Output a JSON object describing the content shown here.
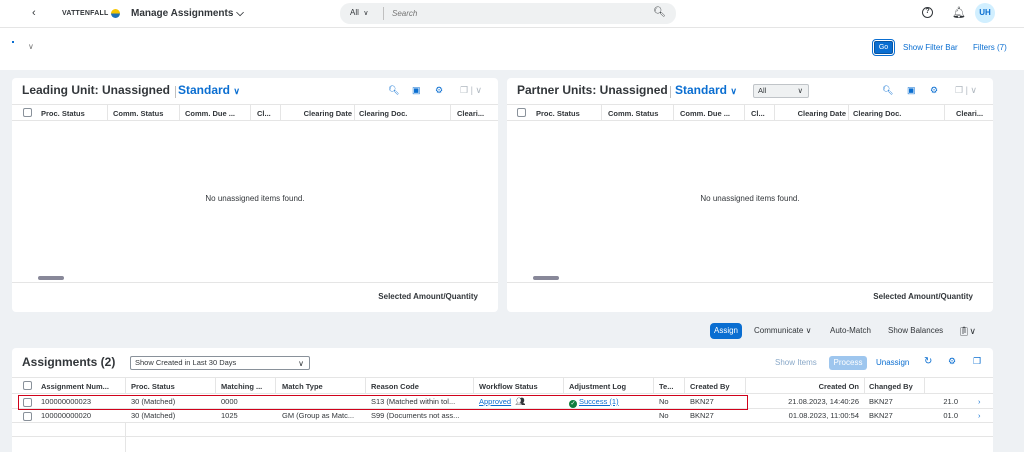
{
  "shell": {
    "back_icon": "chevron-left-icon",
    "logo_text": "VATTENFALL",
    "app_title": "Manage Assignments",
    "search_scope": "All",
    "search_placeholder": "Search",
    "user_initials": "UH"
  },
  "filter_bar": {
    "go_label": "Go",
    "show_filter_bar_label": "Show Filter Bar",
    "filters_label": "Filters (7)"
  },
  "leading_panel": {
    "title": "Leading Unit: Unassigned",
    "variant": "Standard",
    "columns": [
      "Proc. Status",
      "Comm. Status",
      "Comm. Due ...",
      "Cl...",
      "Clearing Date",
      "Clearing Doc.",
      "Cleari..."
    ],
    "empty_text": "No unassigned items found.",
    "footer": "Selected Amount/Quantity"
  },
  "partner_panel": {
    "title": "Partner Units: Unassigned",
    "variant": "Standard",
    "scope_value": "All",
    "columns": [
      "Proc. Status",
      "Comm. Status",
      "Comm. Due ...",
      "Cl...",
      "Clearing Date",
      "Clearing Doc.",
      "Cleari..."
    ],
    "empty_text": "No unassigned items found.",
    "footer": "Selected Amount/Quantity"
  },
  "actions": {
    "assign": "Assign",
    "communicate": "Communicate",
    "auto_match": "Auto-Match",
    "show_balances": "Show Balances"
  },
  "assignments": {
    "title": "Assignments (2)",
    "period_select": "Show Created in Last 30 Days",
    "show_items": "Show Items",
    "process": "Process",
    "unassign": "Unassign",
    "columns": [
      "Assignment Num...",
      "Proc. Status",
      "Matching ...",
      "Match Type",
      "Reason Code",
      "Workflow Status",
      "Adjustment Log",
      "Te...",
      "Created By",
      "Created On",
      "Changed By"
    ],
    "rows": [
      {
        "assignment": "100000000023",
        "proc_status": "30 (Matched)",
        "matching": "0000",
        "match_type": "",
        "reason_code": "S13 (Matched within tol...",
        "workflow_status": "Approved",
        "adjustment_log": "Success (1)",
        "te": "No",
        "created_by": "BKN27",
        "created_on": "21.08.2023, 14:40:26",
        "changed_by": "BKN27",
        "changed_on": "21.0"
      },
      {
        "assignment": "100000000020",
        "proc_status": "30 (Matched)",
        "matching": "1025",
        "match_type": "GM (Group as Matc...",
        "reason_code": "S99 (Documents not ass...",
        "workflow_status": "",
        "adjustment_log": "",
        "te": "No",
        "created_by": "BKN27",
        "created_on": "01.08.2023, 11:00:54",
        "changed_by": "BKN27",
        "changed_on": "01.0"
      }
    ]
  },
  "colors": {
    "accent": "#0a6ed1",
    "highlight": "#d0021b",
    "success": "#107e3e",
    "background": "#eef1f4"
  }
}
